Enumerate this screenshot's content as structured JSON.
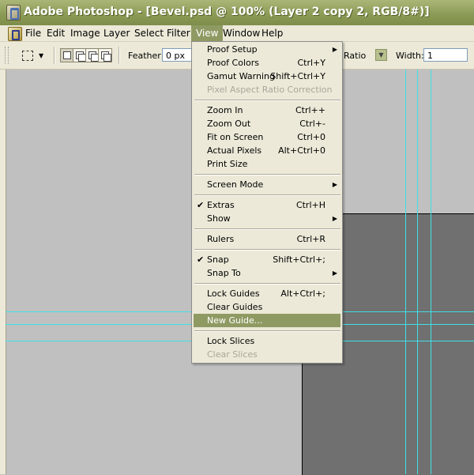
{
  "window": {
    "title": "Adobe Photoshop - [Bevel.psd @ 100% (Layer 2 copy 2, RGB/8#)]"
  },
  "menubar": {
    "items": [
      {
        "label": "File"
      },
      {
        "label": "Edit"
      },
      {
        "label": "Image"
      },
      {
        "label": "Layer"
      },
      {
        "label": "Select"
      },
      {
        "label": "Filter"
      },
      {
        "label": "View"
      },
      {
        "label": "Window"
      },
      {
        "label": "Help"
      }
    ],
    "active": "View"
  },
  "options": {
    "feather_label": "Feather:",
    "feather_value": "0 px",
    "style_value": "Ratio",
    "width_label": "Width:",
    "width_value": "1"
  },
  "view_menu": {
    "items": [
      {
        "label": "Proof Setup",
        "shortcut": "",
        "submenu": true
      },
      {
        "label": "Proof Colors",
        "shortcut": "Ctrl+Y"
      },
      {
        "label": "Gamut Warning",
        "shortcut": "Shift+Ctrl+Y"
      },
      {
        "label": "Pixel Aspect Ratio Correction",
        "shortcut": "",
        "disabled": true
      },
      {
        "label": "Zoom In",
        "shortcut": "Ctrl++"
      },
      {
        "label": "Zoom Out",
        "shortcut": "Ctrl+-"
      },
      {
        "label": "Fit on Screen",
        "shortcut": "Ctrl+0"
      },
      {
        "label": "Actual Pixels",
        "shortcut": "Alt+Ctrl+0"
      },
      {
        "label": "Print Size",
        "shortcut": ""
      },
      {
        "label": "Screen Mode",
        "shortcut": "",
        "submenu": true
      },
      {
        "label": "Extras",
        "shortcut": "Ctrl+H",
        "checked": true
      },
      {
        "label": "Show",
        "shortcut": "",
        "submenu": true
      },
      {
        "label": "Rulers",
        "shortcut": "Ctrl+R"
      },
      {
        "label": "Snap",
        "shortcut": "Shift+Ctrl+;",
        "checked": true
      },
      {
        "label": "Snap To",
        "shortcut": "",
        "submenu": true
      },
      {
        "label": "Lock Guides",
        "shortcut": "Alt+Ctrl+;"
      },
      {
        "label": "Clear Guides",
        "shortcut": ""
      },
      {
        "label": "New Guide...",
        "shortcut": "",
        "highlighted": true
      },
      {
        "label": "Lock Slices",
        "shortcut": ""
      },
      {
        "label": "Clear Slices",
        "shortcut": "",
        "disabled": true
      }
    ]
  },
  "icons": {
    "checkmark": "✔",
    "submenu_arrow": "▶",
    "dropdown_arrow": "▼"
  },
  "colors": {
    "titlebar": "#8a9a55",
    "menu_highlight": "#8f9a63",
    "guide": "#3fe0e6",
    "canvas_dark": "#707070"
  }
}
